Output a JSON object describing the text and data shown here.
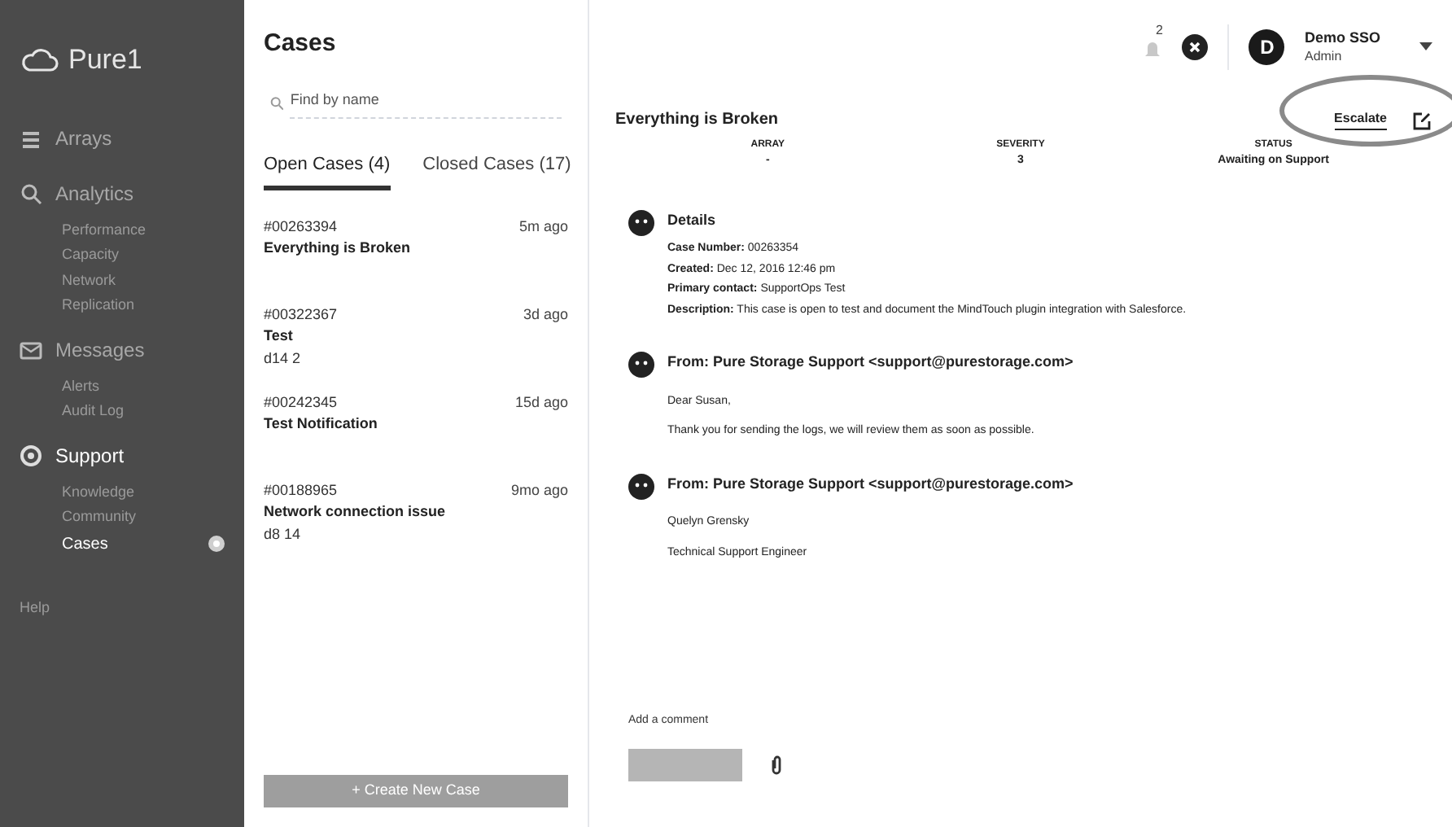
{
  "sidebar": {
    "logo": "Pure1",
    "items": [
      {
        "label": "Arrays",
        "selected": false
      },
      {
        "label": "Analytics",
        "selected": false,
        "children": [
          {
            "label": "Performance",
            "selected": false
          },
          {
            "label": "Capacity",
            "selected": false
          },
          {
            "label": "Network",
            "selected": false
          },
          {
            "label": "Replication",
            "selected": false
          }
        ]
      },
      {
        "label": "Messages",
        "selected": false,
        "children": [
          {
            "label": "Alerts",
            "selected": false
          },
          {
            "label": "Audit Log",
            "selected": false
          }
        ]
      },
      {
        "label": "Support",
        "selected": true,
        "children": [
          {
            "label": "Knowledge",
            "selected": false
          },
          {
            "label": "Community",
            "selected": false
          },
          {
            "label": "Cases",
            "selected": true
          }
        ]
      }
    ],
    "footer": "Help"
  },
  "cases_panel": {
    "title": "Cases",
    "search": {
      "placeholder": "Find by name"
    },
    "tabs": [
      {
        "label": "Open Cases (4)",
        "selected": true
      },
      {
        "label": "Closed Cases (17)",
        "selected": false
      }
    ],
    "cases": [
      {
        "number": "#00263394",
        "title": "Everything is Broken",
        "age": "5m ago"
      },
      {
        "number": "#00322367",
        "title": "Test",
        "extra": "d14 2",
        "age": "3d ago"
      },
      {
        "number": "#00242345",
        "title": "Test Notification",
        "age": "15d ago"
      },
      {
        "number": "#00188965",
        "title": "Network connection issue",
        "extra": "d8 14",
        "age": "9mo ago"
      }
    ],
    "create_button": "+ Create New Case"
  },
  "header": {
    "notification_count": "2",
    "user": {
      "initial": "D",
      "name": "Demo SSO",
      "role": "Admin"
    }
  },
  "case": {
    "title": "Everything is Broken",
    "escalate": "Escalate",
    "fields": [
      {
        "label": "ARRAY",
        "value": "-"
      },
      {
        "label": "SEVERITY",
        "value": "3"
      },
      {
        "label": "STATUS",
        "value": "Awaiting on Support"
      }
    ],
    "entries": [
      {
        "heading": "Details",
        "lines": [
          "**Case Number:** 00263354",
          "**Created:** Dec 12, 2016 12:46 pm",
          "**Primary contact:** SupportOps Test",
          "**Description:** This case is open to test and document the MindTouch plugin integration with Salesforce."
        ]
      },
      {
        "heading": "From: Pure Storage Support <support@purestorage.com>",
        "lines": [
          "Dear Susan,",
          "Thank you for sending the logs, we will review them as soon as possible."
        ]
      },
      {
        "heading": "From: Pure Storage Support <support@purestorage.com>",
        "lines": [
          "Quelyn Grensky",
          "Technical Support Engineer"
        ]
      }
    ],
    "comment": {
      "label": "Add a comment"
    }
  }
}
